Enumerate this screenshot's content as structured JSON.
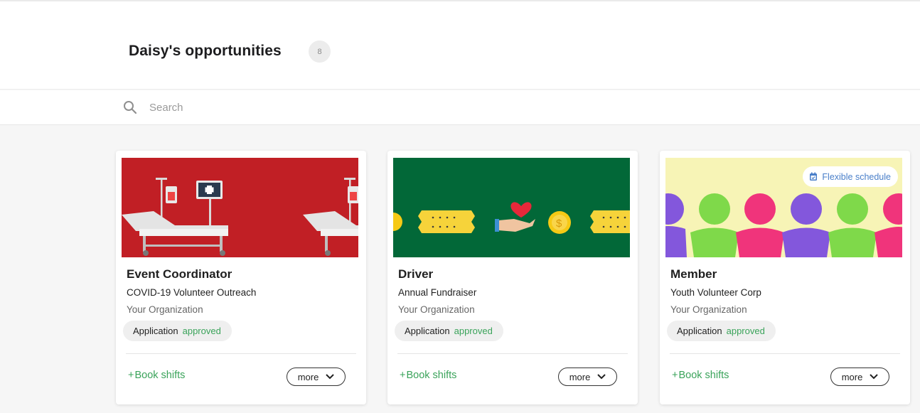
{
  "header": {
    "title": "Daisy's opportunities",
    "count": "8"
  },
  "search": {
    "placeholder": "Search"
  },
  "cards": [
    {
      "role": "Event Coordinator",
      "activity": "COVID-19 Volunteer Outreach",
      "organization": "Your Organization",
      "status_label": "Application",
      "status_value": "approved",
      "book_label": "Book shifts",
      "more_label": "more",
      "banner_color": "#c11f25",
      "banner_illustration": "hospital-beds"
    },
    {
      "role": "Driver",
      "activity": "Annual Fundraiser",
      "organization": "Your Organization",
      "status_label": "Application",
      "status_value": "approved",
      "book_label": "Book shifts",
      "more_label": "more",
      "banner_color": "#026838",
      "banner_illustration": "tickets-donation"
    },
    {
      "role": "Member",
      "activity": "Youth Volunteer Corp",
      "organization": "Your Organization",
      "status_label": "Application",
      "status_value": "approved",
      "book_label": "Book shifts",
      "more_label": "more",
      "badge": "Flexible schedule",
      "banner_color": "#f7f4b6",
      "banner_illustration": "people-chain"
    }
  ],
  "colors": {
    "accent_green": "#3aa35a",
    "badge_blue": "#4a7fc9"
  }
}
